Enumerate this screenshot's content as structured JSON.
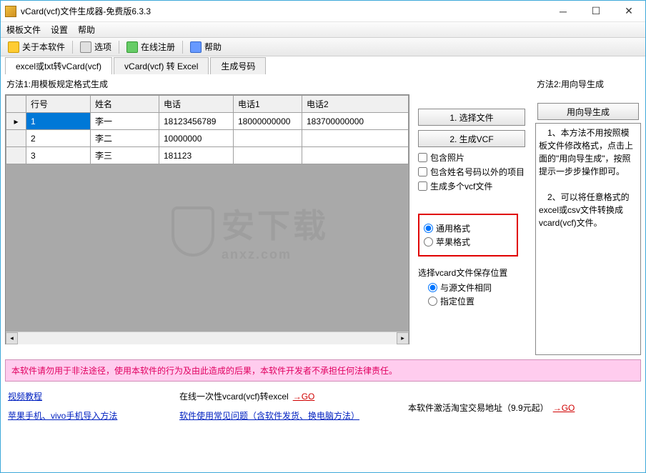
{
  "window": {
    "title": "vCard(vcf)文件生成器-免费版6.3.3"
  },
  "menubar": {
    "file": "模板文件",
    "settings": "设置",
    "help": "帮助"
  },
  "toolbar": {
    "about": "关于本软件",
    "options": "选项",
    "register": "在线注册",
    "help": "帮助"
  },
  "tabs": {
    "t1": "excel或txt转vCard(vcf)",
    "t2": "vCard(vcf) 转 Excel",
    "t3": "生成号码"
  },
  "method1_label": "方法1:用模板规定格式生成",
  "method2_label": "方法2:用向导生成",
  "grid": {
    "headers": {
      "c0": "行号",
      "c1": "姓名",
      "c2": "电话",
      "c3": "电话1",
      "c4": "电话2"
    },
    "rows": [
      {
        "n": "1",
        "name": "李一",
        "tel": "18123456789",
        "tel1": "18000000000",
        "tel2": "183700000000"
      },
      {
        "n": "2",
        "name": "李二",
        "tel": "10000000",
        "tel1": "",
        "tel2": ""
      },
      {
        "n": "3",
        "name": "李三",
        "tel": "181123",
        "tel1": "",
        "tel2": ""
      }
    ]
  },
  "side": {
    "btn_select": "1. 选择文件",
    "btn_gen": "2. 生成VCF",
    "chk_photo": "包含照片",
    "chk_extra": "包含姓名号码以外的项目",
    "chk_multi": "生成多个vcf文件",
    "rad_general": "通用格式",
    "rad_apple": "苹果格式",
    "save_label": "选择vcard文件保存位置",
    "rad_same": "与源文件相同",
    "rad_custom": "指定位置"
  },
  "wizard": {
    "btn": "用向导生成",
    "desc": "　1、本方法不用按照模板文件修改格式，点击上面的\"用向导生成\"，按照提示一步步操作即可。\n\n　2、可以将任意格式的excel或csv文件转换成vcard(vcf)文件。"
  },
  "banner": "本软件请勿用于非法途径，使用本软件的行为及由此造成的后果，本软件开发者不承担任何法律责任。",
  "links": {
    "l1": "视频教程",
    "l2": "苹果手机、vivo手机导入方法",
    "l3": "在线一次性vcard(vcf)转excel",
    "l4": "软件使用常见问题（含软件发货、换电脑方法）",
    "l5": "本软件激活淘宝交易地址（9.9元起）",
    "go": "→GO"
  },
  "watermark": {
    "text": "安下载",
    "sub": "anxz.com"
  }
}
